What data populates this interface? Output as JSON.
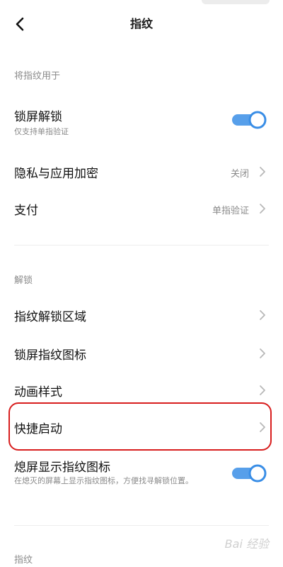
{
  "header": {
    "title": "指纹"
  },
  "sections": {
    "use_for": "将指纹用于",
    "unlock": "解锁",
    "fingerprint": "指纹"
  },
  "rows": {
    "lock_screen": {
      "title": "锁屏解锁",
      "subtitle": "仅支持单指验证",
      "toggle_on": true
    },
    "privacy": {
      "title": "隐私与应用加密",
      "value": "关闭"
    },
    "payment": {
      "title": "支付",
      "value": "单指验证"
    },
    "unlock_area": {
      "title": "指纹解锁区域"
    },
    "lock_icon": {
      "title": "锁屏指纹图标"
    },
    "animation": {
      "title": "动画样式"
    },
    "quick_launch": {
      "title": "快捷启动"
    },
    "screen_off": {
      "title": "熄屏显示指纹图标",
      "subtitle": "在熄灭的屏幕上显示指纹图标，方便找寻解锁位置。",
      "toggle_on": true
    }
  },
  "watermark": "Bai 经验",
  "colors": {
    "accent": "#3a8ee6",
    "highlight": "#d81e1e"
  }
}
